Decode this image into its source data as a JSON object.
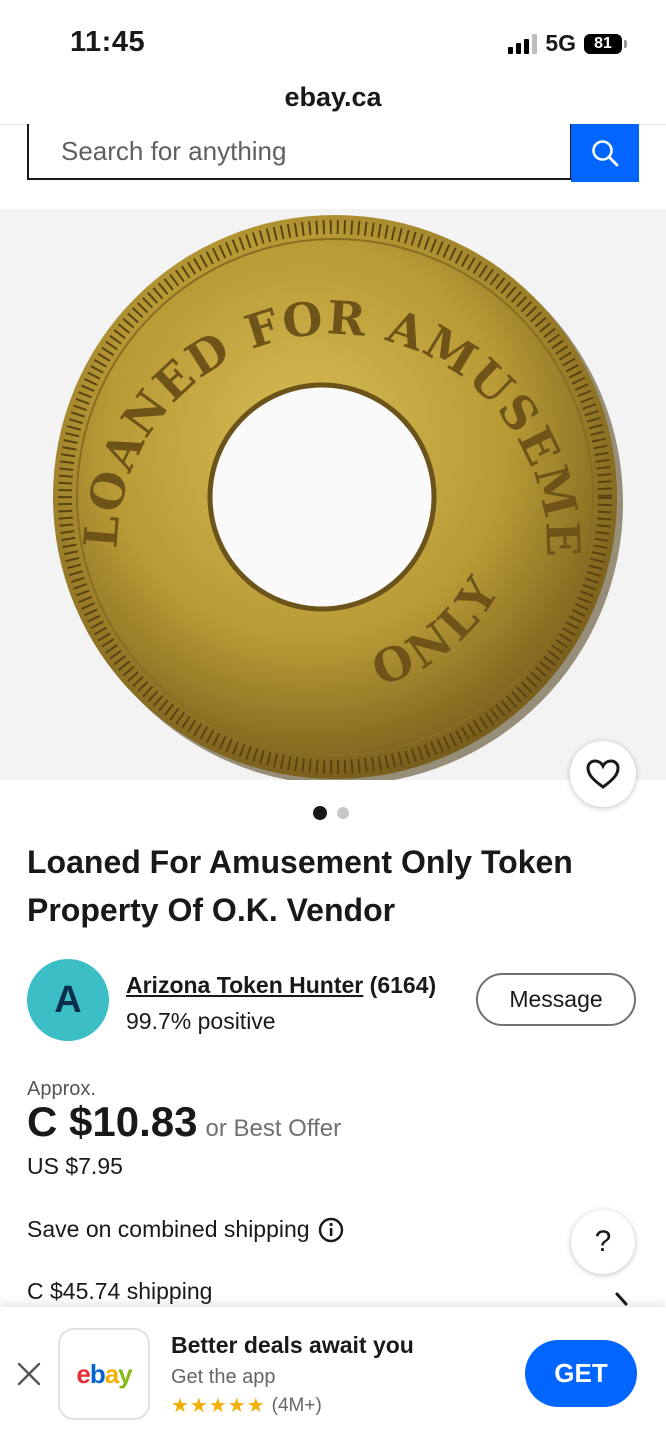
{
  "status_bar": {
    "time": "11:45",
    "network": "5G",
    "battery": "81"
  },
  "browser": {
    "url": "ebay.ca"
  },
  "search": {
    "placeholder": "Search for anything"
  },
  "product": {
    "image": {
      "text_top": "LOANED FOR AMUSEMENT",
      "text_bottom": "ONLY"
    },
    "title": "Loaned For Amusement Only Token Property Of O.K. Vendor",
    "image_count": 2,
    "active_image": 1
  },
  "seller": {
    "initial": "A",
    "name": "Arizona Token Hunter",
    "feedback_count": "(6164)",
    "positive": "99.7% positive",
    "message_label": "Message"
  },
  "price": {
    "approx_label": "Approx.",
    "amount": "C $10.83",
    "best_offer": "or Best Offer",
    "usd": "US $7.95"
  },
  "shipping": {
    "combined_label": "Save on combined shipping",
    "cost": "C $45.74 shipping",
    "help_label": "?"
  },
  "app_banner": {
    "logo_letters": [
      "e",
      "b",
      "a",
      "y"
    ],
    "logo_colors": [
      "#e53238",
      "#0064d2",
      "#f5af02",
      "#86b817"
    ],
    "title": "Better deals await you",
    "subtitle": "Get the app",
    "stars": "★★★★★",
    "rating_count": "(4M+)",
    "get_label": "GET"
  },
  "colors": {
    "accent": "#0066ff",
    "avatar": "#3cbec6",
    "star": "#f5af02"
  }
}
